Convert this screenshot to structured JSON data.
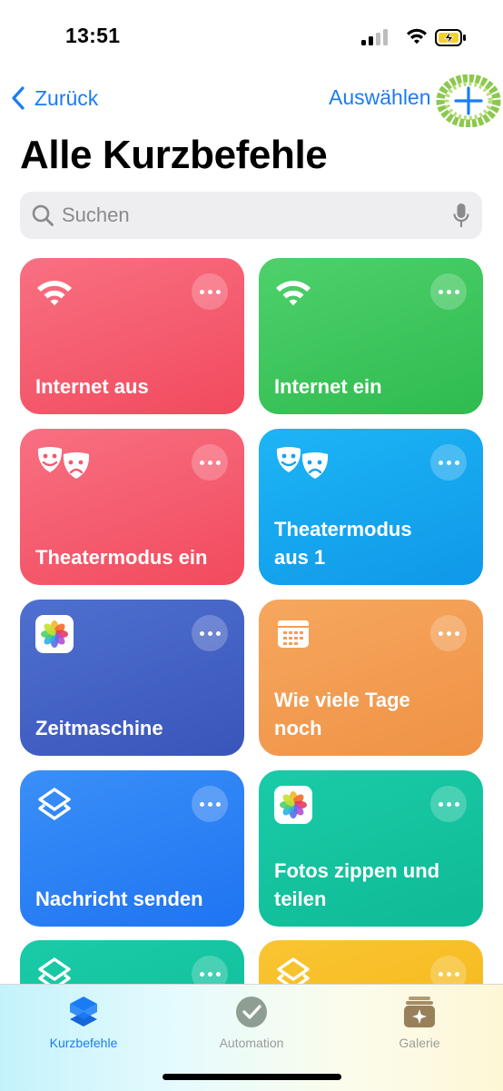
{
  "status": {
    "time": "13:51"
  },
  "nav": {
    "back_label": "Zurück",
    "select_label": "Auswählen"
  },
  "page": {
    "title": "Alle Kurzbefehle"
  },
  "search": {
    "placeholder": "Suchen"
  },
  "tiles": [
    {
      "label": "Internet aus",
      "icon": "wifi-icon",
      "color": "#f5586c"
    },
    {
      "label": "Internet ein",
      "icon": "wifi-icon",
      "color": "#34c254"
    },
    {
      "label": "Theatermodus ein",
      "icon": "theater-masks-icon",
      "color": "#f5586c"
    },
    {
      "label": "Theatermodus\naus 1",
      "icon": "theater-masks-icon",
      "color": "#1aa7f0"
    },
    {
      "label": "Zeitmaschine",
      "icon": "photos-app-icon",
      "color": "#4463c4"
    },
    {
      "label": "Wie viele Tage\nnoch",
      "icon": "calendar-icon",
      "color": "#f39e52"
    },
    {
      "label": "Nachricht senden",
      "icon": "shortcuts-layers-icon",
      "color": "#2c7ff5"
    },
    {
      "label": "Fotos zippen und\nteilen",
      "icon": "photos-app-icon",
      "color": "#12c2a0"
    },
    {
      "label": "",
      "icon": "shortcuts-layers-icon",
      "color": "#12c2a0"
    },
    {
      "label": "",
      "icon": "shortcuts-layers-icon",
      "color": "#f8bd1e"
    }
  ],
  "tabbar": {
    "shortcuts": "Kurzbefehle",
    "automation": "Automation",
    "gallery": "Galerie"
  },
  "colors": {
    "accent": "#1a7cf5",
    "add_button_highlight": "#7fc23a",
    "tab_inactive": "#9b9b9b"
  }
}
